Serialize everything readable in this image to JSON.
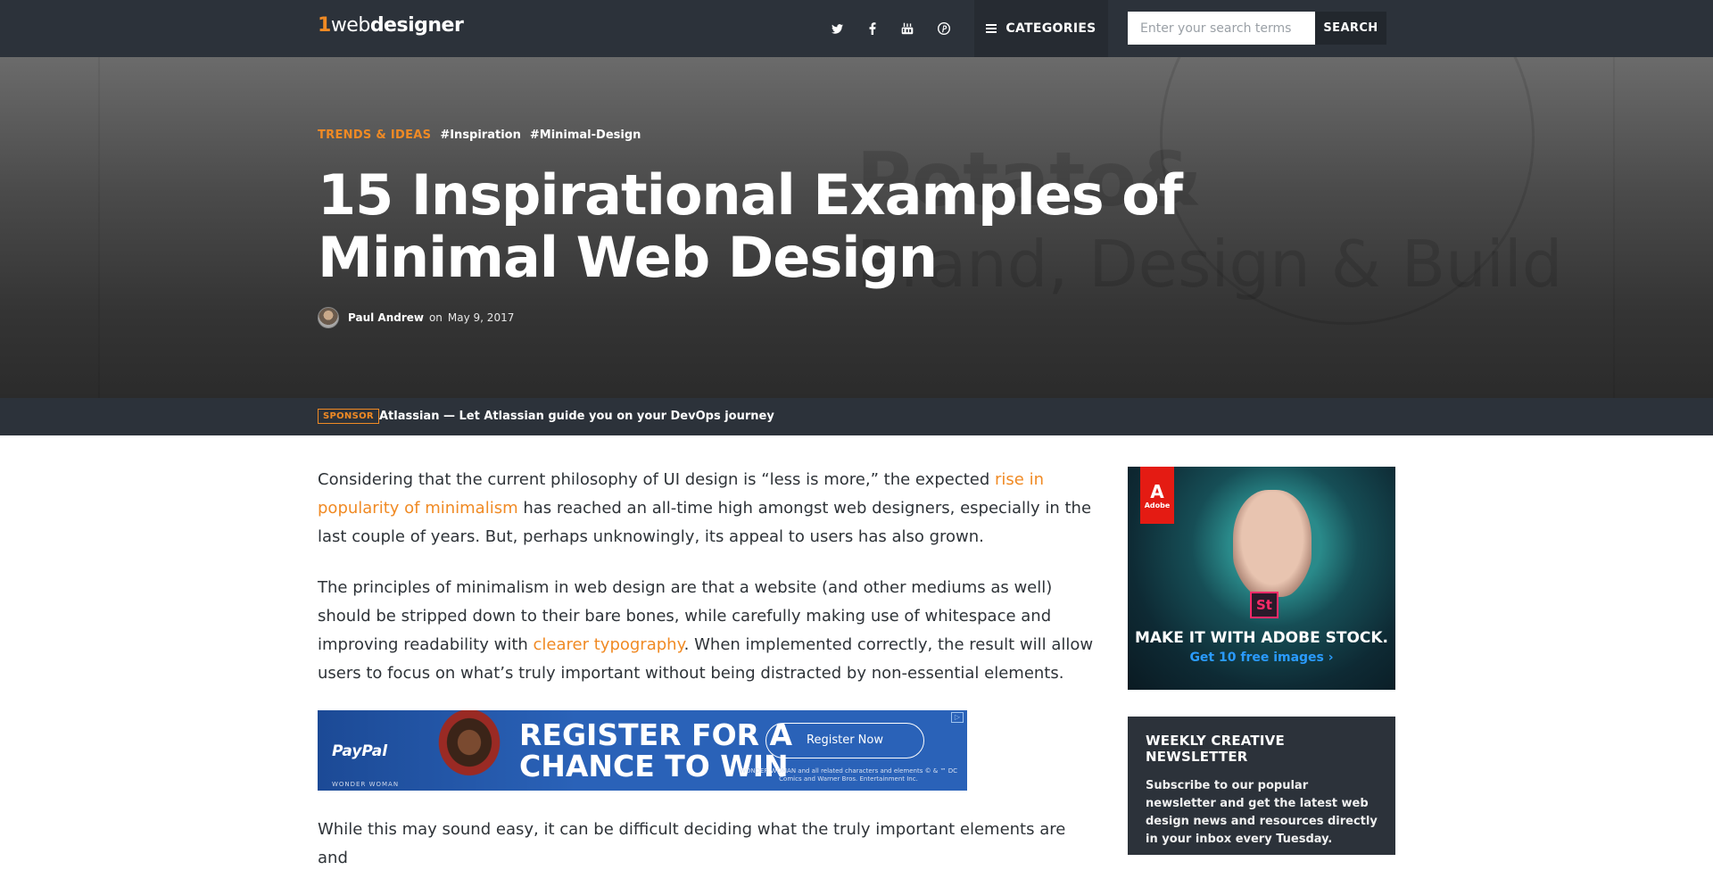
{
  "nav": {
    "logo": {
      "one": "1",
      "web": "web",
      "designer": "designer"
    },
    "social_icons": [
      "twitter-icon",
      "facebook-icon",
      "youtube-icon",
      "pinterest-icon"
    ],
    "categories_label": "CATEGORIES",
    "search": {
      "placeholder": "Enter your search terms",
      "value": "",
      "button": "SEARCH"
    }
  },
  "hero": {
    "category": "TRENDS & IDEAS",
    "tags": [
      "#Inspiration",
      "#Minimal-Design"
    ],
    "title": "15 Inspirational Examples of Minimal Web Design",
    "author": "Paul Andrew",
    "on": "on",
    "date": "May 9, 2017",
    "bg_text_1": "Potato&",
    "bg_text_2": "Brand, Design & Build"
  },
  "sponsor": {
    "badge": "SPONSOR",
    "text": "Atlassian — Let Atlassian guide you on your DevOps journey"
  },
  "article": {
    "p1_before": "Considering that the current philosophy of UI design is “less is more,” the expected ",
    "p1_link": "rise in popularity of minimalism",
    "p1_after": " has reached an all-time high amongst web designers, especially in the last couple of years. But, perhaps unknowingly, its appeal to users has also grown.",
    "p2_before": "The principles of minimalism in web design are that a website (and other mediums as well) should be stripped down to their bare bones, while carefully making use of whitespace and improving readability with ",
    "p2_link": "clearer typography",
    "p2_after": ". When implemented correctly, the result will allow users to focus on what’s truly important without being distracted by non-essential elements.",
    "p3": "While this may sound easy, it can be difficult deciding what the truly important elements are and"
  },
  "banner_ad": {
    "brand": "PayPal",
    "partner": "WONDER WOMAN",
    "headline_1": "REGISTER FOR A",
    "headline_2": "CHANCE TO WIN",
    "button": "Register Now",
    "fine_print": "WONDER WOMAN and all related characters and elements © & ™ DC Comics and Warner Bros. Entertainment Inc."
  },
  "sidebar_ad": {
    "brand": "Adobe",
    "product_glyph": "St",
    "headline": "MAKE IT WITH ADOBE STOCK.",
    "cta": "Get 10 free images ›"
  },
  "newsletter": {
    "title": "WEEKLY CREATIVE NEWSLETTER",
    "text": "Subscribe to our popular newsletter and get the latest web design news and resources directly in your inbox every Tuesday."
  },
  "colors": {
    "accent": "#f08a24",
    "nav_bg": "#2c323a",
    "link": "#f08a24",
    "adobe_red": "#e41b13",
    "adobe_stock_pink": "#ff2a68",
    "cta_blue": "#2a9bff"
  }
}
